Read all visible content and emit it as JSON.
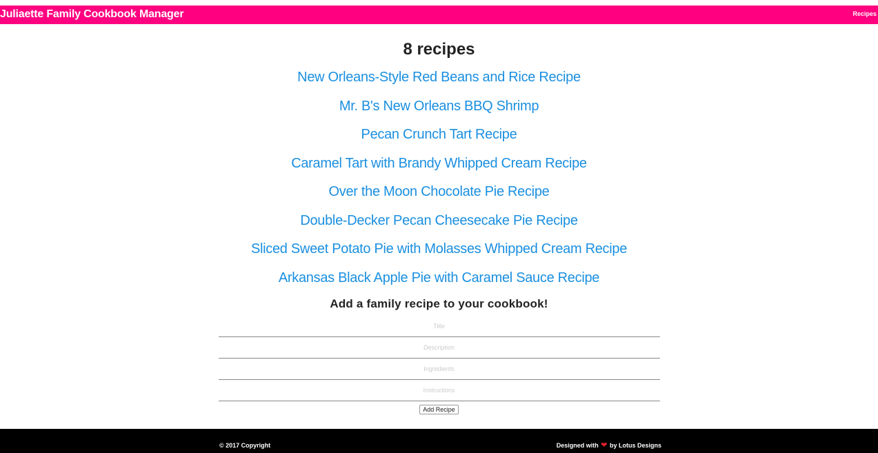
{
  "header": {
    "brand": "Juliaette Family Cookbook Manager",
    "nav_recipes": "Recipes",
    "accent": "#ff0080"
  },
  "main": {
    "count_label": "8 recipes",
    "recipes": [
      "New Orleans-Style Red Beans and Rice Recipe",
      "Mr. B's New Orleans BBQ Shrimp",
      "Pecan Crunch Tart Recipe",
      "Caramel Tart with Brandy Whipped Cream Recipe",
      "Over the Moon Chocolate Pie Recipe",
      "Double-Decker Pecan Cheesecake Pie Recipe",
      "Sliced Sweet Potato Pie with Molasses Whipped Cream Recipe",
      "Arkansas Black Apple Pie with Caramel Sauce Recipe"
    ],
    "link_color": "#1a8fe0"
  },
  "form": {
    "heading": "Add a family recipe to your cookbook!",
    "title_placeholder": "Title",
    "description_placeholder": "Description",
    "ingredients_placeholder": "Ingredients",
    "instructions_placeholder": "Instructions",
    "submit_label": "Add Recipe"
  },
  "footer": {
    "copyright": "© 2017 Copyright",
    "credit_prefix": "Designed with",
    "heart_icon": "heart-icon",
    "credit_suffix": "by Lotus Designs"
  }
}
